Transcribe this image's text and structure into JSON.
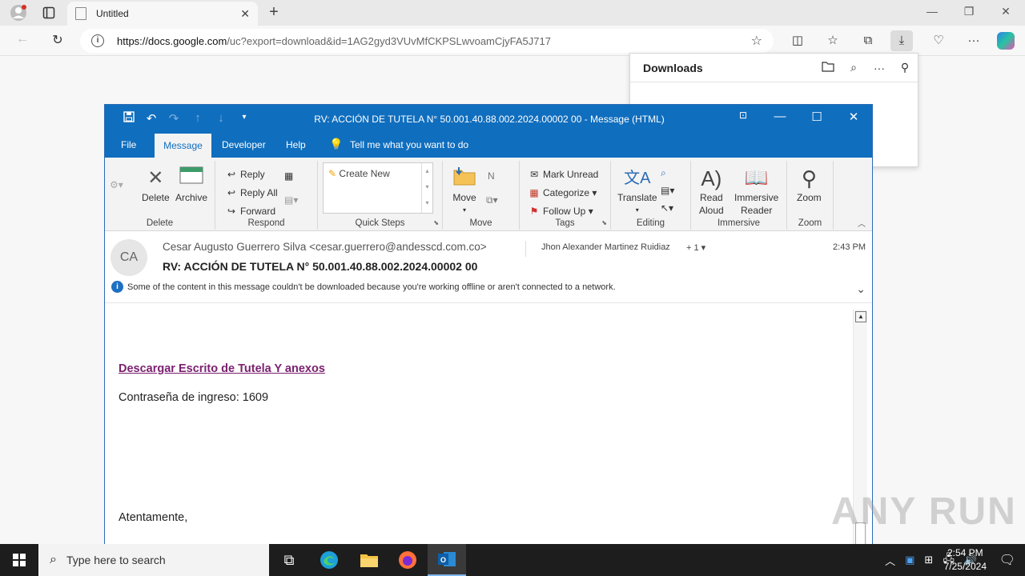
{
  "browser": {
    "tab_title": "Untitled",
    "url_host": "https://docs.google.com",
    "url_path": "/uc?export=download&id=1AG2gyd3VUvMfCKPSLwvoamCjyFA5J717"
  },
  "downloads_panel": {
    "title": "Downloads"
  },
  "outlook": {
    "window_title": "RV: ACCIÓN DE TUTELA N° 50.001.40.88.002.2024.00002 00  -  Message (HTML)",
    "menu": [
      "File",
      "Message",
      "Developer",
      "Help"
    ],
    "tell_me": "Tell me what you want to do",
    "ribbon": {
      "delete_group": "Delete",
      "delete": "Delete",
      "archive": "Archive",
      "respond_group": "Respond",
      "reply": "Reply",
      "reply_all": "Reply All",
      "forward": "Forward",
      "quicksteps_group": "Quick Steps",
      "create_new": "Create New",
      "move_group": "Move",
      "move": "Move",
      "tags_group": "Tags",
      "mark_unread": "Mark Unread",
      "categorize": "Categorize",
      "follow_up": "Follow Up",
      "editing_group": "Editing",
      "translate": "Translate",
      "immersive_group": "Immersive",
      "read_aloud_1": "Read",
      "read_aloud_2": "Aloud",
      "immersive_1": "Immersive",
      "immersive_2": "Reader",
      "zoom_group": "Zoom",
      "zoom": "Zoom"
    },
    "message": {
      "avatar_initials": "CA",
      "from": "Cesar Augusto Guerrero Silva <cesar.guerrero@andesscd.com.co>",
      "to": "Jhon Alexander Martinez Ruidiaz",
      "more_recipients": "+ 1",
      "time": "2:43 PM",
      "subject": "RV: ACCIÓN DE TUTELA N° 50.001.40.88.002.2024.00002 00",
      "info": "Some of the content in this message couldn't be downloaded because you're working offline or aren't connected to a network.",
      "link_text": "Descargar Escrito de Tutela Y anexos",
      "password_line": "Contraseña de ingreso: 1609",
      "closing": "Atentamente,"
    }
  },
  "watermark": "ANY RUN",
  "taskbar": {
    "search_placeholder": "Type here to search",
    "time": "2:54 PM",
    "date": "7/25/2024"
  }
}
